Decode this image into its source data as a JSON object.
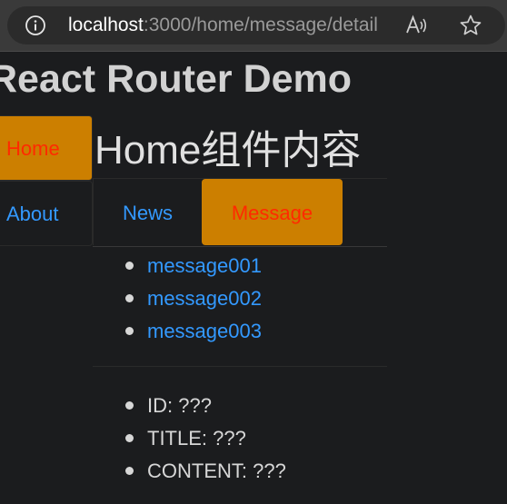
{
  "browser": {
    "url_host": "localhost",
    "url_path": ":3000/home/message/detail",
    "icons": [
      "info-icon",
      "read-aloud-icon",
      "star-icon"
    ]
  },
  "app": {
    "title": "React Router Demo"
  },
  "side_nav": {
    "items": [
      {
        "label": "Home",
        "active": true
      },
      {
        "label": "About",
        "active": false
      }
    ]
  },
  "home": {
    "title": "Home组件内容",
    "tabs": [
      {
        "label": "News",
        "active": false
      },
      {
        "label": "Message",
        "active": true
      }
    ]
  },
  "messages": {
    "items": [
      "message001",
      "message002",
      "message003"
    ]
  },
  "detail": {
    "id": "ID: ???",
    "title": "TITLE: ???",
    "content": "CONTENT: ???"
  },
  "colors": {
    "background": "#1b1c1e",
    "active_bg": "#cc7f00",
    "active_text": "#ff2a00",
    "link": "#3399ff",
    "text": "#d7d7d7"
  }
}
